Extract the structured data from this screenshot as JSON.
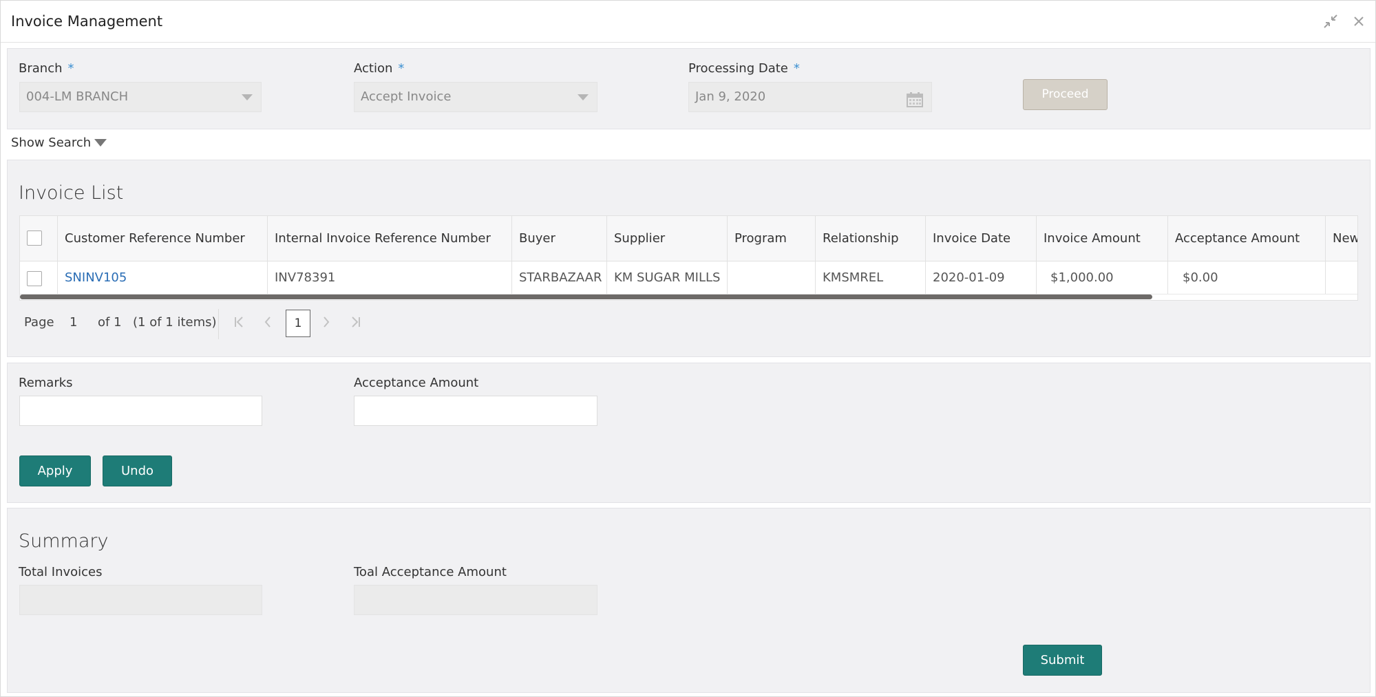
{
  "window": {
    "title": "Invoice Management",
    "icons": {
      "minimize": "compress-icon",
      "close": "close-icon"
    }
  },
  "filters": {
    "branch": {
      "label": "Branch",
      "value": "004-LM BRANCH"
    },
    "action": {
      "label": "Action",
      "value": "Accept Invoice"
    },
    "processing_date": {
      "label": "Processing Date",
      "value": "Jan 9, 2020"
    },
    "required_marker": "*",
    "proceed_label": "Proceed"
  },
  "show_search": {
    "label": "Show Search"
  },
  "invoice_list": {
    "title": "Invoice List",
    "columns": [
      "Customer Reference Number",
      "Internal Invoice Reference Number",
      "Buyer",
      "Supplier",
      "Program",
      "Relationship",
      "Invoice Date",
      "Invoice Amount",
      "Acceptance Amount",
      "New"
    ],
    "rows": [
      {
        "customer_ref": "SNINV105",
        "internal_ref": "INV78391",
        "buyer": "STARBAZAAR",
        "supplier": "KM SUGAR MILLS",
        "program": "",
        "relationship": "KMSMREL",
        "invoice_date": "2020-01-09",
        "invoice_amount": "$1,000.00",
        "acceptance_amount": "$0.00",
        "new": ""
      }
    ],
    "pager": {
      "page_label": "Page",
      "page_value": "1",
      "of_label": "of 1",
      "items_label": "(1 of 1 items)",
      "current_page": "1"
    }
  },
  "edit": {
    "remarks_label": "Remarks",
    "remarks_value": "",
    "acceptance_amount_label": "Acceptance Amount",
    "acceptance_amount_value": "",
    "apply_label": "Apply",
    "undo_label": "Undo"
  },
  "summary": {
    "title": "Summary",
    "total_invoices_label": "Total Invoices",
    "total_invoices_value": "",
    "total_acceptance_label": "Toal Acceptance Amount",
    "total_acceptance_value": "",
    "submit_label": "Submit"
  },
  "colors": {
    "teal_button": "#1e7c77",
    "link": "#2a6db5",
    "required": "#3b8fd1",
    "proceed_disabled": "#d6d1c8"
  }
}
